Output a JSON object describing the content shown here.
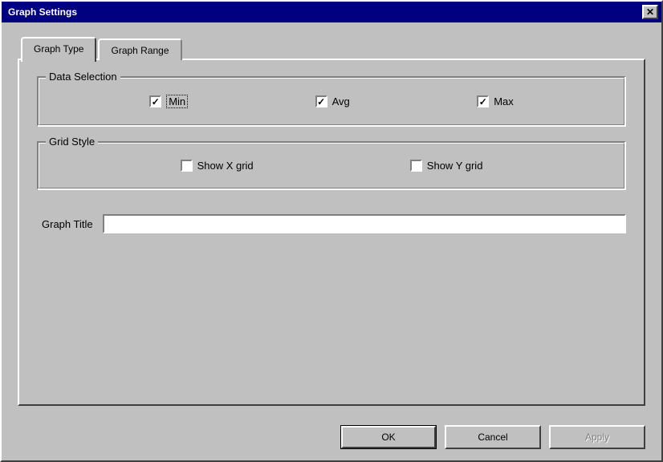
{
  "window": {
    "title": "Graph Settings"
  },
  "tabs": {
    "graph_type": "Graph Type",
    "graph_range": "Graph Range"
  },
  "groups": {
    "data_selection": {
      "legend": "Data Selection",
      "min": "Min",
      "avg": "Avg",
      "max": "Max"
    },
    "grid_style": {
      "legend": "Grid Style",
      "show_x": "Show X grid",
      "show_y": "Show Y grid"
    }
  },
  "graph_title": {
    "label": "Graph Title",
    "value": ""
  },
  "buttons": {
    "ok": "OK",
    "cancel": "Cancel",
    "apply": "Apply"
  }
}
